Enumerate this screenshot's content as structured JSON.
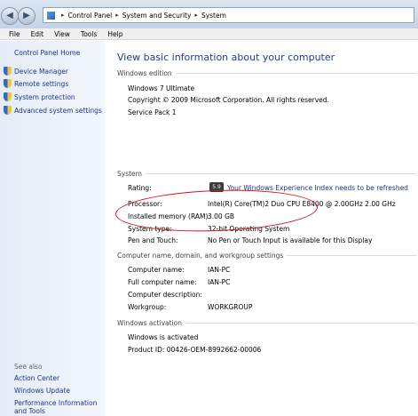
{
  "address_bar": {
    "nav_back": "◀",
    "nav_forward": "▶",
    "breadcrumbs": [
      "Control Panel",
      "System and Security",
      "System"
    ],
    "separator": "▸"
  },
  "menu": [
    "File",
    "Edit",
    "View",
    "Tools",
    "Help"
  ],
  "sidebar": {
    "home": "Control Panel Home",
    "links": [
      "Device Manager",
      "Remote settings",
      "System protection",
      "Advanced system settings"
    ],
    "see_also_heading": "See also",
    "see_also": [
      "Action Center",
      "Windows Update",
      "Performance Information and Tools"
    ]
  },
  "main": {
    "title": "View basic information about your computer",
    "windows_edition": {
      "heading": "Windows edition",
      "name": "Windows 7 Ultimate",
      "copyright": "Copyright © 2009 Microsoft Corporation.  All rights reserved.",
      "service_pack": "Service Pack 1"
    },
    "system": {
      "heading": "System",
      "rating_label": "Rating:",
      "rating_badge": "5.9",
      "rating_link": "Your Windows Experience Index needs to be refreshed",
      "processor_label": "Processor:",
      "processor_value": "Intel(R) Core(TM)2 Duo CPU    E8400  @ 2.00GHz   2.00 GHz",
      "memory_label": "Installed memory (RAM):",
      "memory_value": "3.00 GB",
      "type_label": "System type:",
      "type_value": "32-bit Operating System",
      "pen_label": "Pen and Touch:",
      "pen_value": "No Pen or Touch Input is available for this Display"
    },
    "computer": {
      "heading": "Computer name, domain, and workgroup settings",
      "name_label": "Computer name:",
      "name_value": "IAN-PC",
      "full_label": "Full computer name:",
      "full_value": "IAN-PC",
      "desc_label": "Computer description:",
      "workgroup_label": "Workgroup:",
      "workgroup_value": "WORKGROUP"
    },
    "activation": {
      "heading": "Windows activation",
      "status": "Windows is activated",
      "product_id": "Product ID: 00426-OEM-8992662-00006"
    }
  },
  "colors": {
    "link": "#1e3287",
    "title": "#1e3f8a",
    "annotation": "#d11a1a"
  }
}
